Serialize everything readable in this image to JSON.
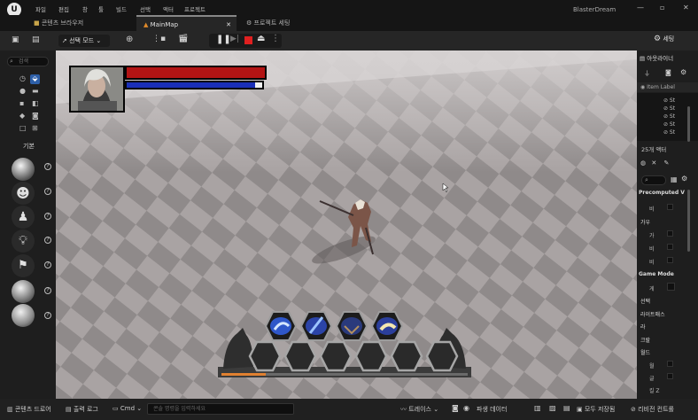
{
  "menubar": {
    "items": [
      "파일",
      "편집",
      "창",
      "툴",
      "빌드",
      "선택",
      "액터",
      "프로젝트"
    ],
    "window_title": "BlasterDream"
  },
  "tabs": [
    {
      "label": "콘텐츠 브라우저"
    },
    {
      "label": "MainMap"
    },
    {
      "label": "프로젝트 세팅"
    }
  ],
  "toolbar": {
    "select_mode": "선택 모드",
    "settings": "세팅"
  },
  "left_panel": {
    "search_placeholder": "검색",
    "category": "기본"
  },
  "hud": {
    "health_ratio": 1.0,
    "mana_ratio": 0.95,
    "health_color": "#b31414",
    "mana_color": "#1a2fb8",
    "xp_ratio": 0.18
  },
  "right_panel": {
    "outliner_title": "아웃라이너",
    "outliner_header": "Item Label",
    "actor_count": "25개 액터",
    "details": {
      "section1": "Precomputed V",
      "section2": "가우",
      "section3": "Game Mode",
      "section4": "선택",
      "section5": "라이트매스",
      "section6": "라",
      "section7": "크랄",
      "section8": "월드",
      "row1": "비",
      "row2": "가",
      "row3": "비",
      "row4": "비",
      "row5": "게",
      "row6": "월",
      "row7": "글",
      "row8": "킬 Z"
    }
  },
  "statusbar": {
    "content_drawer": "콘텐츠 드로어",
    "output_log": "출력 로그",
    "cmd": "Cmd",
    "console_placeholder": "콘솔 명령을 입력하세요",
    "trace": "트레이스",
    "derived_data": "파생 데이터",
    "save_all": "모두 저장됨",
    "revision_control": "리비전 컨트롤"
  }
}
